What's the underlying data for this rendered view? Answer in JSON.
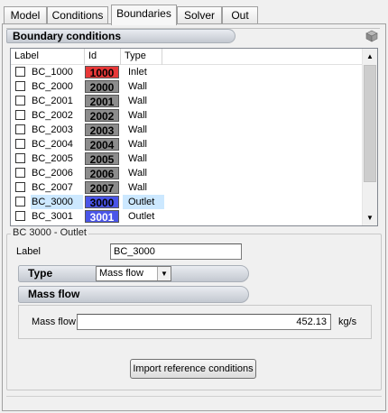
{
  "tabs": [
    {
      "label": "Model",
      "active": false
    },
    {
      "label": "Conditions",
      "active": false
    },
    {
      "label": "Boundaries",
      "active": true
    },
    {
      "label": "Solver",
      "active": false
    },
    {
      "label": "Out",
      "active": false
    }
  ],
  "header": {
    "title": "Boundary conditions",
    "icon": "cube-icon"
  },
  "list": {
    "columns": [
      "Label",
      "Id",
      "Type"
    ],
    "rows": [
      {
        "label": "BC_1000",
        "id": "1000",
        "type": "Inlet",
        "color": "#e83838",
        "id_text_color": "#000000",
        "checked": false,
        "selected": false
      },
      {
        "label": "BC_2000",
        "id": "2000",
        "type": "Wall",
        "color": "#8c8c8c",
        "id_text_color": "#000000",
        "checked": false,
        "selected": false
      },
      {
        "label": "BC_2001",
        "id": "2001",
        "type": "Wall",
        "color": "#8c8c8c",
        "id_text_color": "#000000",
        "checked": false,
        "selected": false
      },
      {
        "label": "BC_2002",
        "id": "2002",
        "type": "Wall",
        "color": "#8c8c8c",
        "id_text_color": "#000000",
        "checked": false,
        "selected": false
      },
      {
        "label": "BC_2003",
        "id": "2003",
        "type": "Wall",
        "color": "#8c8c8c",
        "id_text_color": "#000000",
        "checked": false,
        "selected": false
      },
      {
        "label": "BC_2004",
        "id": "2004",
        "type": "Wall",
        "color": "#8c8c8c",
        "id_text_color": "#000000",
        "checked": false,
        "selected": false
      },
      {
        "label": "BC_2005",
        "id": "2005",
        "type": "Wall",
        "color": "#8c8c8c",
        "id_text_color": "#000000",
        "checked": false,
        "selected": false
      },
      {
        "label": "BC_2006",
        "id": "2006",
        "type": "Wall",
        "color": "#8c8c8c",
        "id_text_color": "#000000",
        "checked": false,
        "selected": false
      },
      {
        "label": "BC_2007",
        "id": "2007",
        "type": "Wall",
        "color": "#8c8c8c",
        "id_text_color": "#000000",
        "checked": false,
        "selected": false
      },
      {
        "label": "BC_3000",
        "id": "3000",
        "type": "Outlet",
        "color": "#4a55e8",
        "id_text_color": "#000000",
        "checked": false,
        "selected": true
      },
      {
        "label": "BC_3001",
        "id": "3001",
        "type": "Outlet",
        "color": "#4a55e8",
        "id_text_color": "#ffffff",
        "checked": false,
        "selected": false
      }
    ]
  },
  "detail": {
    "group_title": "BC 3000 - Outlet",
    "label_caption": "Label",
    "label_value": "BC_3000",
    "type_caption": "Type",
    "type_value": "Mass flow",
    "mass_flow_section": "Mass flow",
    "mass_flow_caption": "Mass flow",
    "mass_flow_value": "452.13",
    "mass_flow_unit": "kg/s",
    "import_button": "Import reference conditions"
  }
}
